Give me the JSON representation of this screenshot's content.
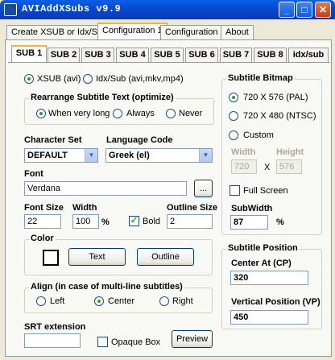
{
  "window": {
    "title": "AVIAddXSubs v9.9",
    "min": "_",
    "max": "□",
    "close": "✕"
  },
  "tabs": [
    "Create XSUB or Idx/Sub",
    "Configuration 1",
    "Configuration 2",
    "About"
  ],
  "subtabs": [
    "SUB 1",
    "SUB 2",
    "SUB 3",
    "SUB 4",
    "SUB 5",
    "SUB 6",
    "SUB 7",
    "SUB 8",
    "idx/sub"
  ],
  "format": {
    "xsub": "XSUB (avi)",
    "idxsub": "Idx/Sub (avi,mkv,mp4)"
  },
  "rearrange": {
    "title": "Rearrange Subtitle Text (optimize)",
    "opt1": "When very long",
    "opt2": "Always",
    "opt3": "Never"
  },
  "charset": {
    "label": "Character Set",
    "value": "DEFAULT"
  },
  "language": {
    "label": "Language Code",
    "value": "Greek (el)"
  },
  "font": {
    "label": "Font",
    "value": "Verdana",
    "browse": "..."
  },
  "fontsize": {
    "label": "Font Size",
    "value": "22"
  },
  "width": {
    "label": "Width",
    "value": "100",
    "unit": "%"
  },
  "bold": {
    "label": "Bold"
  },
  "outline": {
    "label": "Outline Size",
    "value": "2"
  },
  "color": {
    "title": "Color",
    "text": "Text",
    "outline": "Outline"
  },
  "align": {
    "title": "Align (in case of multi-line subtitles)",
    "left": "Left",
    "center": "Center",
    "right": "Right"
  },
  "srt": {
    "label": "SRT extension",
    "value": "",
    "opaque": "Opaque Box",
    "preview": "Preview"
  },
  "bitmap": {
    "title": "Subtitle Bitmap",
    "pal": "720 X 576 (PAL)",
    "ntsc": "720 X 480 (NTSC)",
    "custom": "Custom",
    "width_label": "Width",
    "height_label": "Height",
    "width": "720",
    "x": "X",
    "height": "576",
    "fullscreen": "Full Screen",
    "subwidth_label": "SubWidth",
    "subwidth": "87",
    "subwidth_unit": "%"
  },
  "position": {
    "title": "Subtitle Position",
    "center_label": "Center At (CP)",
    "center": "320",
    "vert_label": "Vertical Position (VP)",
    "vert": "450"
  }
}
